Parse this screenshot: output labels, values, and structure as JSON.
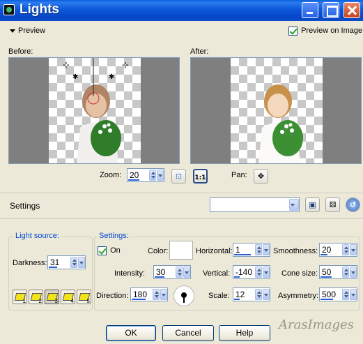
{
  "window": {
    "title": "Lights"
  },
  "preview": {
    "toggle_label": "Preview",
    "preview_on_image_label": "Preview on Image",
    "preview_on_image_checked": true,
    "before_label": "Before:",
    "after_label": "After:"
  },
  "zoom": {
    "label": "Zoom:",
    "value": "20",
    "one_to_one": "1:1"
  },
  "pan": {
    "label": "Pan:"
  },
  "settings_bar": {
    "label": "Settings",
    "preset_value": ""
  },
  "light_source": {
    "group_label": "Light source:",
    "darkness_label": "Darkness:",
    "darkness_value": "31",
    "presets": [
      "1",
      "2",
      "3",
      "4",
      "5"
    ]
  },
  "settings": {
    "group_label": "Settings:",
    "on_label": "On",
    "on_checked": true,
    "color_label": "Color:",
    "color_value": "#ffffff",
    "intensity_label": "Intensity:",
    "intensity_value": "30",
    "direction_label": "Direction:",
    "direction_value": "180",
    "horizontal_label": "Horizontal:",
    "horizontal_value": "1",
    "vertical_label": "Vertical:",
    "vertical_value": "-140",
    "scale_label": "Scale:",
    "scale_value": "12",
    "smoothness_label": "Smoothness:",
    "smoothness_value": "20",
    "cone_size_label": "Cone size:",
    "cone_size_value": "50",
    "asymmetry_label": "Asymmetry:",
    "asymmetry_value": "500"
  },
  "buttons": {
    "ok": "OK",
    "cancel": "Cancel",
    "help": "Help"
  },
  "watermark": "ArasImages"
}
